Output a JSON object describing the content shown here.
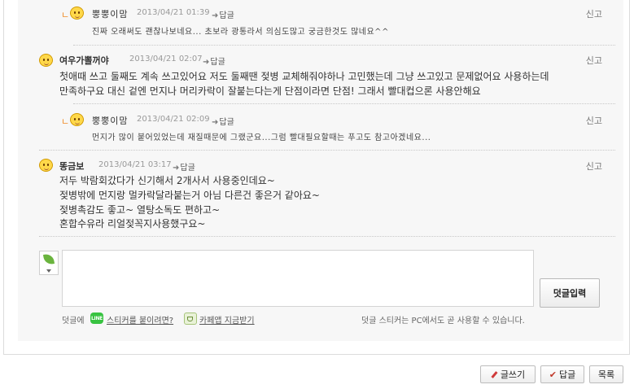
{
  "comments": [
    {
      "nick": "뿡뿡이맘",
      "date": "2013/04/21 01:39",
      "reply_label": "답글",
      "report_label": "신고",
      "lines": [
        "진짜 오래써도 괜찮나보네요... 초보라 광통라서 의심도많고 궁금한것도 많네요^^"
      ]
    },
    {
      "nick": "여우가뽈꺼야",
      "date": "2013/04/21 02:07",
      "reply_label": "답글",
      "report_label": "신고",
      "lines": [
        "첫애때 쓰고 둘째도 계속 쓰고있어요 저도 둘째땐 젖병 교체해줘야하나 고민했는데 그냥 쓰고있고 문제없어요 사용하는데",
        "만족하구요 대신 겉엔 먼지나 머리카락이 잘붙는다는게 단점이라면 단점! 그래서 빨대컵으론 사용안해요"
      ]
    },
    {
      "nick": "뿡뿡이맘",
      "date": "2013/04/21 02:09",
      "reply_label": "답글",
      "report_label": "신고",
      "lines": [
        "먼지가 많이 붙어있었는데 재질때문에 그랬군요...그럼 빨대필요할때는 푸고도 참고아겠네요..."
      ]
    },
    {
      "nick": "똥금보",
      "date": "2013/04/21 03:17",
      "reply_label": "답글",
      "report_label": "신고",
      "lines": [
        "저두 박람회갔다가 신기해서 2개사서 사용중인데요~",
        "젖병밖에 먼지랑 멀카락달라붙는거 아님 다른건 좋은거 같아요~",
        "젖병촉감도 좋고~ 열탕소독도 편하고~",
        "혼합수유라 리얼젖꼭지사용했구요~"
      ]
    }
  ],
  "comment_form": {
    "submit_label": "덧글입력",
    "hint_prefix": "덧글에",
    "line_icon_text": "LINE",
    "sticker_link": "스티커를 붙이려면?",
    "cafe_link": "카페앱 지금받기",
    "hint_right": "덧글 스티커는 PC에서도 곧 사용할 수 있습니다."
  },
  "bottom_buttons": {
    "write": "글쓰기",
    "reply": "답글",
    "list": "목록"
  },
  "colors": {
    "panel_bg": "#f7f7f7",
    "line_green": "#38c341",
    "reply_arrow": "#f08a24"
  }
}
